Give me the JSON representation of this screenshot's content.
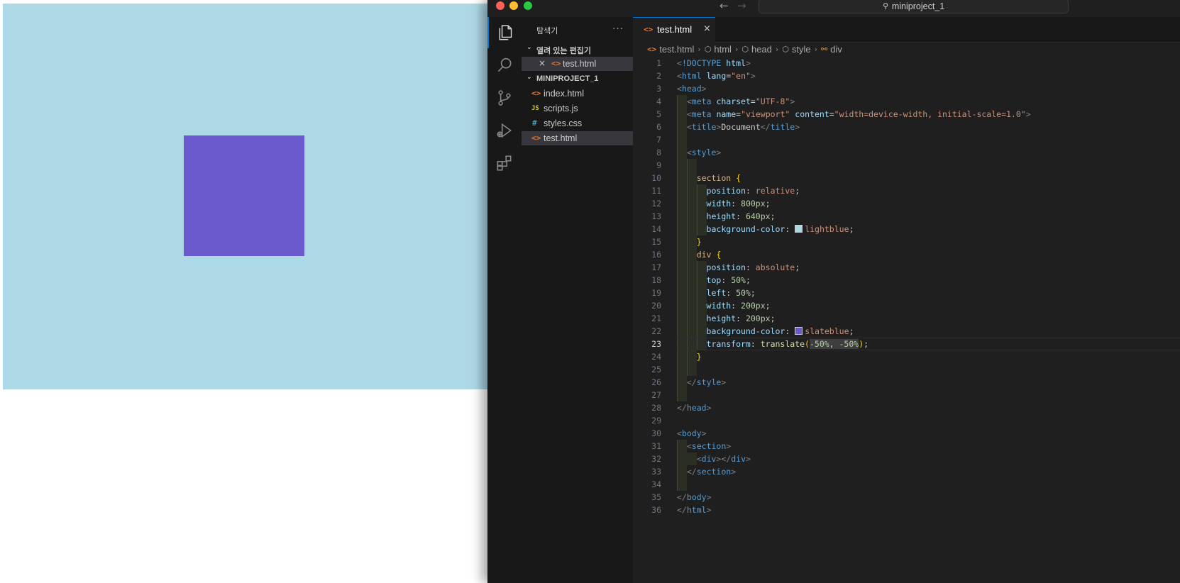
{
  "colors": {
    "preview_section": "#add8e6",
    "preview_box": "#6a5acd",
    "editor_bg": "#1f1f1f",
    "sidebar_bg": "#181818",
    "accent": "#0078d4"
  },
  "titlebar": {
    "command_center": "miniproject_1"
  },
  "activity_bar": [
    "files-icon",
    "search-icon",
    "source-control-icon",
    "run-debug-icon",
    "extensions-icon"
  ],
  "sidebar": {
    "title": "탐색기",
    "more": "···",
    "open_editors": {
      "label": "열려 있는 편집기",
      "items": [
        {
          "name": "test.html"
        }
      ]
    },
    "project": {
      "label": "MINIPROJECT_1",
      "files": [
        {
          "name": "index.html",
          "icon": "<>"
        },
        {
          "name": "scripts.js",
          "icon": "JS"
        },
        {
          "name": "styles.css",
          "icon": "#"
        },
        {
          "name": "test.html",
          "icon": "<>"
        }
      ]
    }
  },
  "editor": {
    "tab": "test.html",
    "breadcrumb": [
      "test.html",
      "html",
      "head",
      "style",
      "div"
    ],
    "current_line": 23,
    "lines": [
      "<!DOCTYPE html>",
      "<html lang=\"en\">",
      "<head>",
      "  <meta charset=\"UTF-8\">",
      "  <meta name=\"viewport\" content=\"width=device-width, initial-scale=1.0\">",
      "  <title>Document</title>",
      "",
      "  <style>",
      "",
      "    section {",
      "      position: relative;",
      "      width: 800px;",
      "      height: 640px;",
      "      background-color: lightblue;",
      "    }",
      "    div {",
      "      position: absolute;",
      "      top: 50%;",
      "      left: 50%;",
      "      width: 200px;",
      "      height: 200px;",
      "      background-color: slateblue;",
      "      transform: translate(-50%, -50%);",
      "    }",
      "",
      "  </style>",
      "",
      "</head>",
      "",
      "<body>",
      "  <section>",
      "    <div></div>",
      "  </section>",
      "",
      "</body>",
      "</html>"
    ]
  }
}
